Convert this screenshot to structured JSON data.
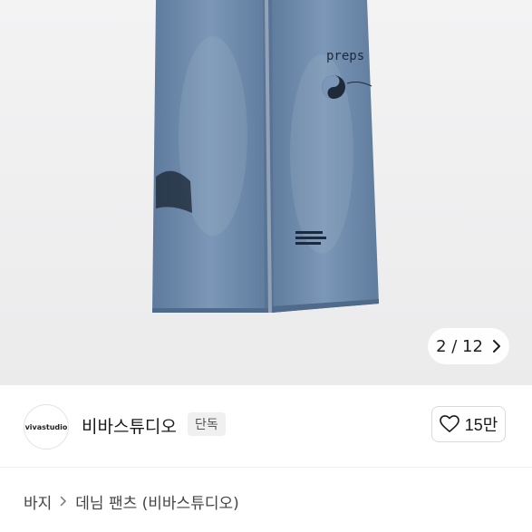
{
  "gallery": {
    "position_label": "2 / 12",
    "next_icon": "chevron-right-icon",
    "jeans_prints": [
      "preps"
    ]
  },
  "shop": {
    "avatar_text": "vivastudio",
    "name": "비바스튜디오",
    "badge": "단독"
  },
  "like": {
    "icon": "heart-outline-icon",
    "count": "15만"
  },
  "breadcrumb": {
    "category": "바지",
    "separator_icon": "chevron-right-icon",
    "product": "데님 팬츠 (비바스튜디오)"
  },
  "colors": {
    "denim": "#6f8bab",
    "denim_dark": "#5a7596",
    "background": "#efeff0"
  }
}
